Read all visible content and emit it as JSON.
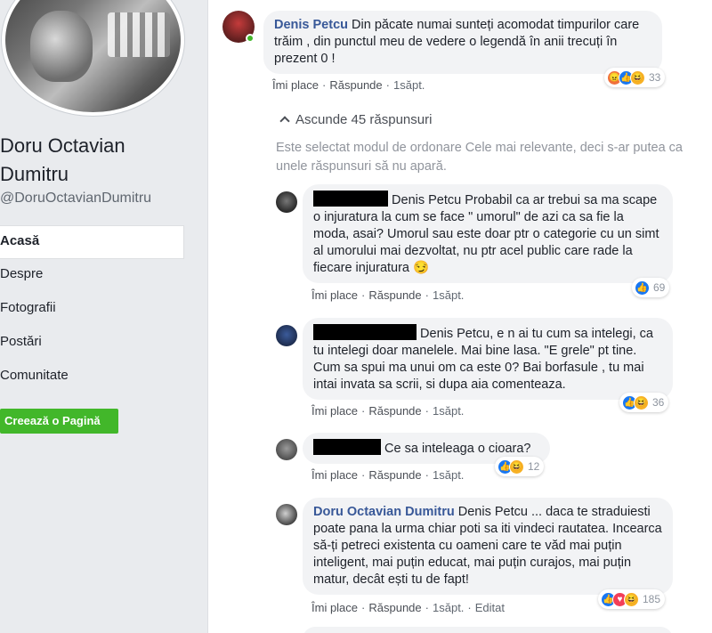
{
  "sidebar": {
    "page_name": "Doru Octavian Dumitru",
    "handle": "@DoruOctavianDumitru",
    "nav": [
      "Acasă",
      "Despre",
      "Fotografii",
      "Postări",
      "Comunitate"
    ],
    "create_page": "Creează o Pagină"
  },
  "comments": {
    "c1": {
      "author": "Denis Petcu",
      "text": "Din păcate numai sunteți acomodat timpurilor care trăim , din punctul meu de vedere o legendă în anii trecuți în prezent 0 !",
      "like": "Îmi place",
      "reply": "Răspunde",
      "time": "1săpt.",
      "reaction_count": "33"
    },
    "hide_replies": "Ascunde 45 răspunsuri",
    "sort_note": "Este selectat modul de ordonare Cele mai relevante, deci s-ar putea ca unele răspunsuri să nu apară.",
    "r1": {
      "text": "Denis Petcu Probabil ca ar trebui sa ma scape o injuratura la cum se face \" umorul\" de azi ca sa fie la moda, asai? Umorul sau este doar ptr o categorie cu un simt al umorului mai dezvoltat, nu ptr acel public care rade la fiecare injuratura 😏",
      "like": "Îmi place",
      "reply": "Răspunde",
      "time": "1săpt.",
      "reaction_count": "69"
    },
    "r2": {
      "text": "Denis Petcu, e n ai tu cum sa intelegi, ca tu intelegi doar manelele. Mai bine lasa. \"E grele\" pt tine. Cum sa spui ma unui om ca este 0? Bai borfasule , tu mai intai invata sa scrii, si dupa aia comenteaza.",
      "like": "Îmi place",
      "reply": "Răspunde",
      "time": "1săpt.",
      "reaction_count": "36"
    },
    "r3": {
      "text": "Ce sa inteleaga o cioara?",
      "like": "Îmi place",
      "reply": "Răspunde",
      "time": "1săpt.",
      "reaction_count": "12"
    },
    "r4": {
      "author": "Doru Octavian Dumitru",
      "text": "Denis Petcu ... daca te straduiesti poate pana la urma chiar poti sa iti vindeci rautatea. Incearca să-ți petreci existenta cu oameni care te văd mai puțin inteligent, mai puțin educat, mai puțin curajos, mai puțin matur, decât ești tu de fapt!",
      "like": "Îmi place",
      "reply": "Răspunde",
      "time": "1săpt.",
      "edited": "Editat",
      "reaction_count": "185"
    }
  },
  "colors": {
    "link": "#385898",
    "accent_green": "#42b72a",
    "like_blue": "#1877f2"
  }
}
